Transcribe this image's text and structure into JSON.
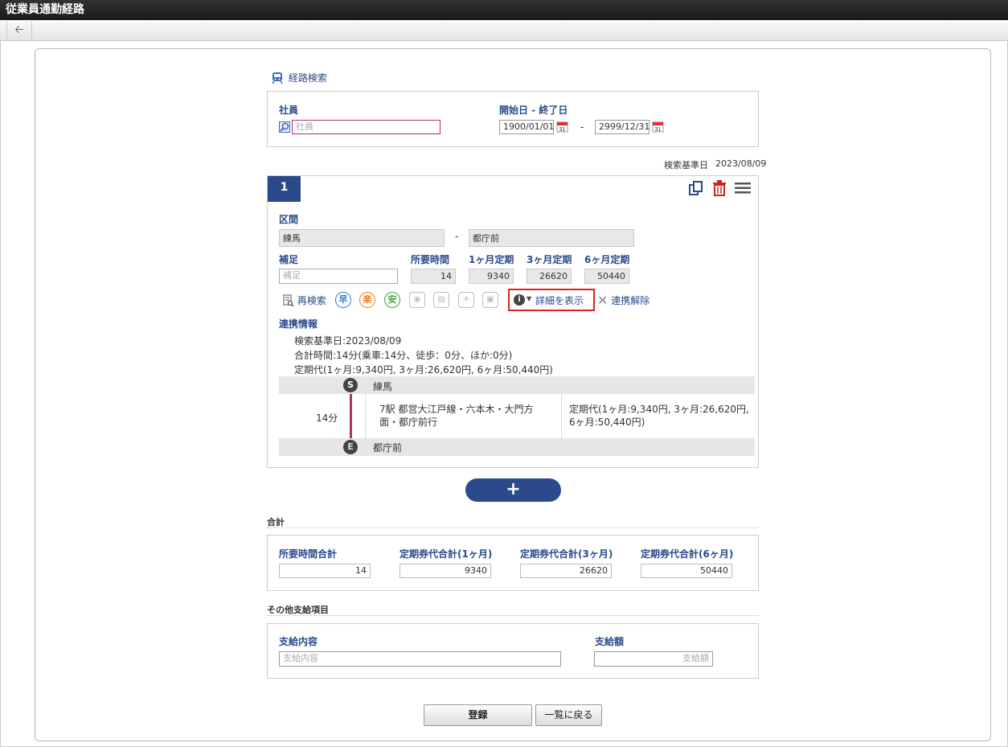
{
  "app": {
    "title": "従業員通勤経路"
  },
  "search_link": "経路検索",
  "employee": {
    "label": "社員",
    "placeholder": "社員"
  },
  "period": {
    "label": "開始日 - 終了日",
    "start": "1900/01/01",
    "separator": "-",
    "end": "2999/12/31"
  },
  "base_date": {
    "label": "検索基準日",
    "value": "2023/08/09"
  },
  "route": {
    "number": "1",
    "section_label": "区間",
    "from": "練馬",
    "dash": "-",
    "to": "都庁前",
    "supplement_label": "補足",
    "supplement_placeholder": "補足",
    "time_label": "所要時間",
    "time_value": "14",
    "pass1_label": "1ヶ月定期",
    "pass1_value": "9340",
    "pass3_label": "3ヶ月定期",
    "pass3_value": "26620",
    "pass6_label": "6ヶ月定期",
    "pass6_value": "50440",
    "research_label": "再検索",
    "fast_label": "早",
    "easy_label": "楽",
    "cheap_label": "安",
    "details_label": "詳細を表示",
    "unlink_label": "連携解除",
    "link_info_label": "連携情報",
    "info_lines": [
      "検索基準日:2023/08/09",
      "合計時間:14分(乗車:14分、徒歩：0分、ほか:0分)",
      "定期代(1ヶ月:9,340円, 3ヶ月:26,620円, 6ヶ月:50,440円)"
    ],
    "start_badge": "S",
    "start_station": "練馬",
    "segment_time": "14分",
    "segment_line": "7駅 都営大江戸線・六本木・大門方面・都庁前行",
    "segment_fare": "定期代(1ヶ月:9,340円, 3ヶ月:26,620円, 6ヶ月:50,440円)",
    "end_badge": "E",
    "end_station": "都庁前"
  },
  "add_button": "+",
  "totals": {
    "section_title": "合計",
    "time_label": "所要時間合計",
    "time_value": "14",
    "p1_label": "定期券代合計(1ヶ月)",
    "p1_value": "9340",
    "p3_label": "定期券代合計(3ヶ月)",
    "p3_value": "26620",
    "p6_label": "定期券代合計(6ヶ月)",
    "p6_value": "50440"
  },
  "other": {
    "section_title": "その他支給項目",
    "content_label": "支給内容",
    "content_placeholder": "支給内容",
    "amount_label": "支給額",
    "amount_placeholder": "支給額"
  },
  "buttons": {
    "register": "登録",
    "back_to_list": "一覧に戻る"
  },
  "colors": {
    "accent": "#2a4a8c",
    "highlight": "#e02020",
    "route_line": "#b0306a"
  }
}
